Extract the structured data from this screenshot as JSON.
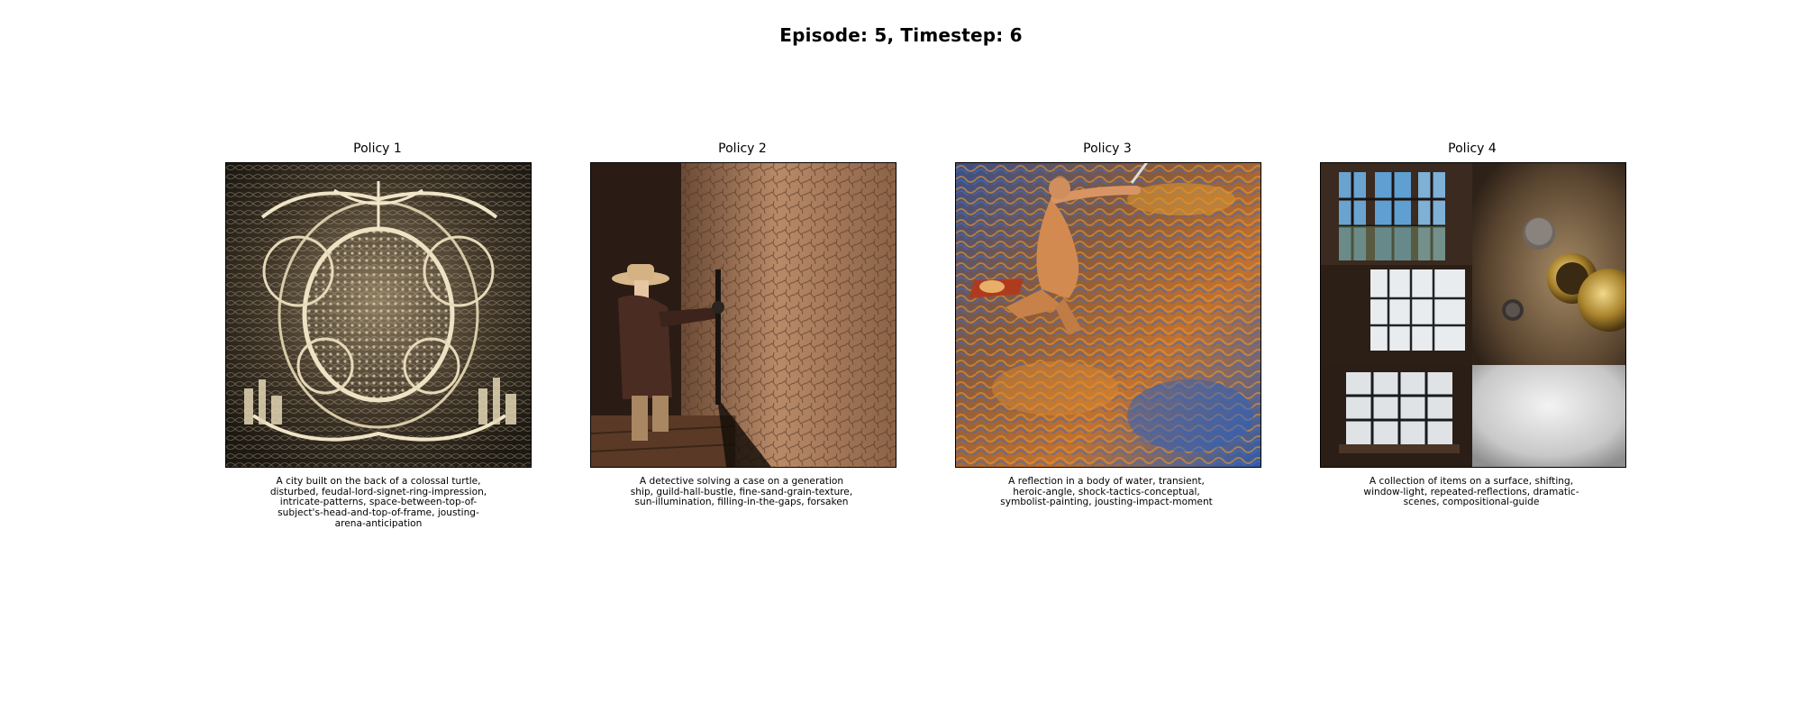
{
  "figure": {
    "title": "Episode: 5, Timestep: 6"
  },
  "panels": [
    {
      "title": "Policy 1",
      "caption": "A city built on the back of a colossal turtle, disturbed, feudal-lord-signet-ring-impression, intricate-patterns, space-between-top-of-subject's-head-and-top-of-frame, jousting-arena-anticipation"
    },
    {
      "title": "Policy 2",
      "caption": "A detective solving a case on a generation ship, guild-hall-bustle, fine-sand-grain-texture, sun-illumination, filling-in-the-gaps, forsaken"
    },
    {
      "title": "Policy 3",
      "caption": "A reflection in a body of water, transient, heroic-angle, shock-tactics-conceptual, symbolist-painting, jousting-impact-moment"
    },
    {
      "title": "Policy 4",
      "caption": "A collection of items on a surface, shifting, window-light, repeated-reflections, dramatic-scenes, compositional-guide"
    }
  ]
}
